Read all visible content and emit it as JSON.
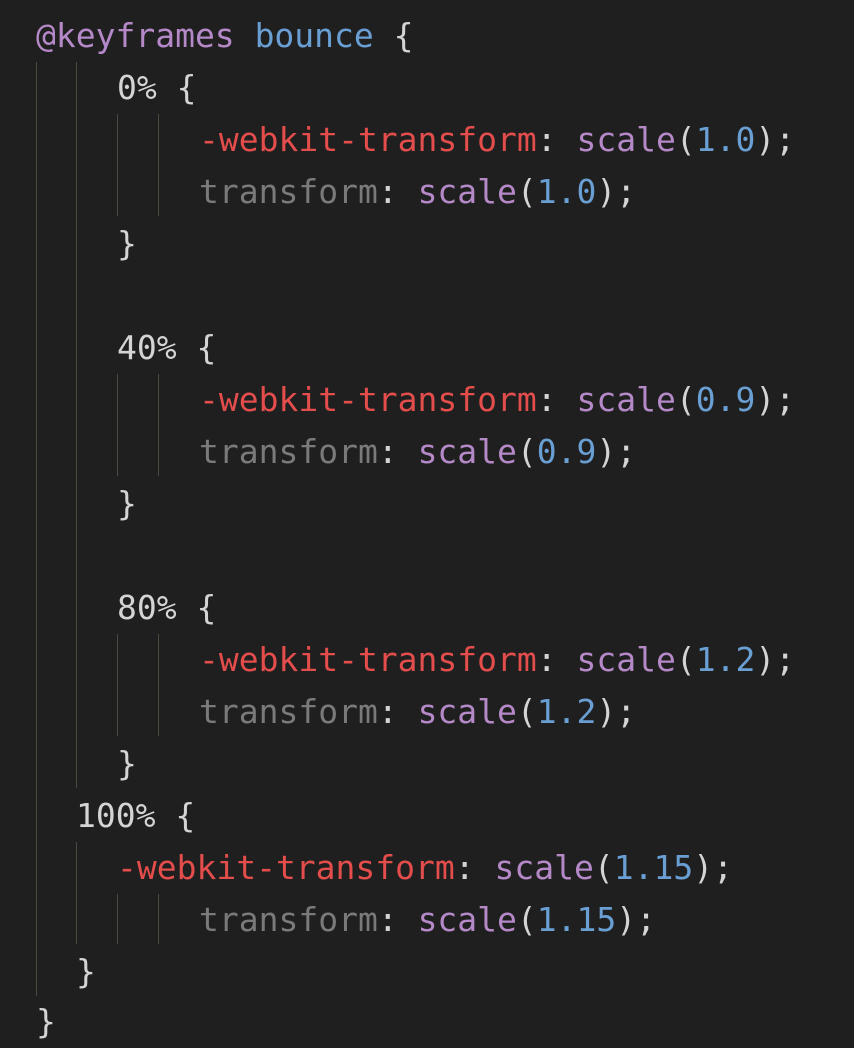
{
  "editor": {
    "background": "#1f1f1f",
    "colors": {
      "at_rule": "#b589c8",
      "animation_name": "#6a9fd4",
      "vendor_prefixed_property": "#e34d4b",
      "deprecated_property": "#7a7a7a",
      "function": "#b589c8",
      "number": "#6a9fd4",
      "default_text": "#d4d4d4",
      "indent_guide": "#4a4a40"
    },
    "lines": [
      {
        "at": "@keyframes",
        "name": "bounce",
        "brace": "{"
      },
      {
        "selector": "0%",
        "brace": "{"
      },
      {
        "prop": "-webkit-transform",
        "colon": ":",
        "fn": "scale",
        "open": "(",
        "num": "1.0",
        "close": ");"
      },
      {
        "prop": "transform",
        "colon": ":",
        "fn": "scale",
        "open": "(",
        "num": "1.0",
        "close": ");"
      },
      {
        "brace": "}"
      },
      {},
      {
        "selector": "40%",
        "brace": "{"
      },
      {
        "prop": "-webkit-transform",
        "colon": ":",
        "fn": "scale",
        "open": "(",
        "num": "0.9",
        "close": ");"
      },
      {
        "prop": "transform",
        "colon": ":",
        "fn": "scale",
        "open": "(",
        "num": "0.9",
        "close": ");"
      },
      {
        "brace": "}"
      },
      {},
      {
        "selector": "80%",
        "brace": "{"
      },
      {
        "prop": "-webkit-transform",
        "colon": ":",
        "fn": "scale",
        "open": "(",
        "num": "1.2",
        "close": ");"
      },
      {
        "prop": "transform",
        "colon": ":",
        "fn": "scale",
        "open": "(",
        "num": "1.2",
        "close": ");"
      },
      {
        "brace": "}"
      },
      {
        "selector": "100%",
        "brace": "{"
      },
      {
        "prop": "-webkit-transform",
        "colon": ":",
        "fn": "scale",
        "open": "(",
        "num": "1.15",
        "close": ");"
      },
      {
        "prop": "transform",
        "colon": ":",
        "fn": "scale",
        "open": "(",
        "num": "1.15",
        "close": ");"
      },
      {
        "brace": "}"
      },
      {
        "brace": "}"
      }
    ]
  }
}
